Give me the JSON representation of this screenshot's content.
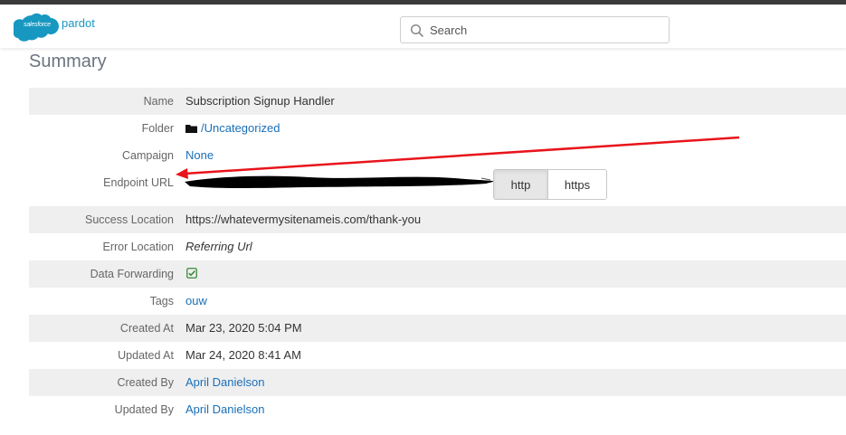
{
  "header": {
    "logo_cloud_text": "salesforce",
    "logo_product_text": "pardot",
    "search_placeholder": "Search"
  },
  "page_title": "Summary",
  "rows": [
    {
      "label": "Name",
      "value": "Subscription Signup Handler"
    },
    {
      "label": "Folder",
      "value": "/Uncategorized"
    },
    {
      "label": "Campaign",
      "value": "None"
    },
    {
      "label": "Endpoint URL",
      "value": "",
      "redacted": true,
      "protocol_options": [
        "http",
        "https"
      ],
      "protocol_selected": "http"
    },
    {
      "label": "Success Location",
      "value": "https://whatevermysitenameis.com/thank-you"
    },
    {
      "label": "Error Location",
      "value": "Referring Url"
    },
    {
      "label": "Data Forwarding",
      "value_icon": "check-square-icon"
    },
    {
      "label": "Tags",
      "value": "ouw"
    },
    {
      "label": "Created At",
      "value": "Mar 23, 2020 5:04 PM"
    },
    {
      "label": "Updated At",
      "value": "Mar 24, 2020 8:41 AM"
    },
    {
      "label": "Created By",
      "value": "April Danielson"
    },
    {
      "label": "Updated By",
      "value": "April Danielson"
    }
  ],
  "colors": {
    "link": "#1a6fb9",
    "brand_cloud": "#1798c1",
    "annotation_arrow": "#e8141b",
    "check": "#3a8a3a"
  },
  "annotation": {
    "type": "arrow",
    "points_to": "Endpoint URL"
  }
}
